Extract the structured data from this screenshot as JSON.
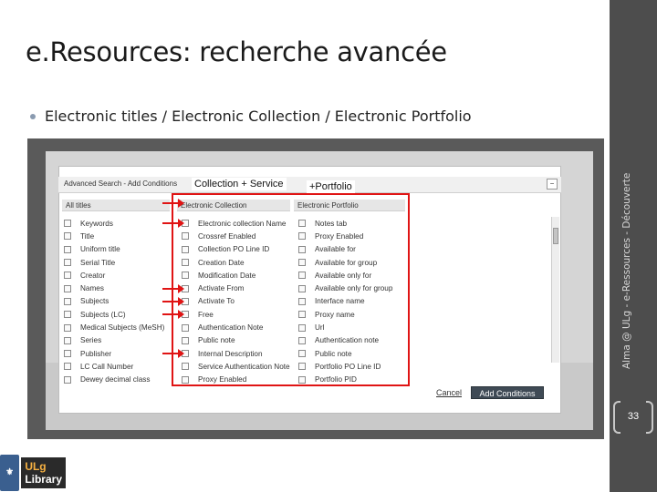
{
  "slide": {
    "title": "e.Resources: recherche avancée",
    "bullet": "Electronic titles / Electronic Collection / Electronic Portfolio",
    "side_label": "Alma @ ULg - e-Ressources - Découverte",
    "page_number": "33"
  },
  "logo": {
    "line1": "ULg",
    "line2": "Library"
  },
  "screenshot": {
    "header_title": "Advanced Search - Add Conditions",
    "annotations": {
      "collection": "Collection + Service",
      "portfolio": "+Portfolio"
    },
    "columns": [
      {
        "header": "All titles",
        "items": [
          "Keywords",
          "Title",
          "Uniform title",
          "Serial Title",
          "Creator",
          "Names",
          "Subjects",
          "Subjects (LC)",
          "Medical Subjects (MeSH)",
          "Series",
          "Publisher",
          "LC Call Number",
          "Dewey decimal class"
        ]
      },
      {
        "header": "Electronic Collection",
        "items": [
          "Electronic collection Name",
          "Crossref Enabled",
          "Collection PO Line ID",
          "Creation Date",
          "Modification Date",
          "Activate From",
          "Activate To",
          "Free",
          "Authentication Note",
          "Public note",
          "Internal Description",
          "Service Authentication Note",
          "Proxy Enabled"
        ]
      },
      {
        "header": "Electronic Portfolio",
        "items": [
          "Notes tab",
          "Proxy Enabled",
          "Available for",
          "Available for group",
          "Available only for",
          "Available only for group",
          "Interface name",
          "Proxy name",
          "Url",
          "Authentication note",
          "Public note",
          "Portfolio PO Line ID",
          "Portfolio PID"
        ]
      }
    ],
    "buttons": {
      "cancel": "Cancel",
      "add": "Add Conditions"
    }
  }
}
